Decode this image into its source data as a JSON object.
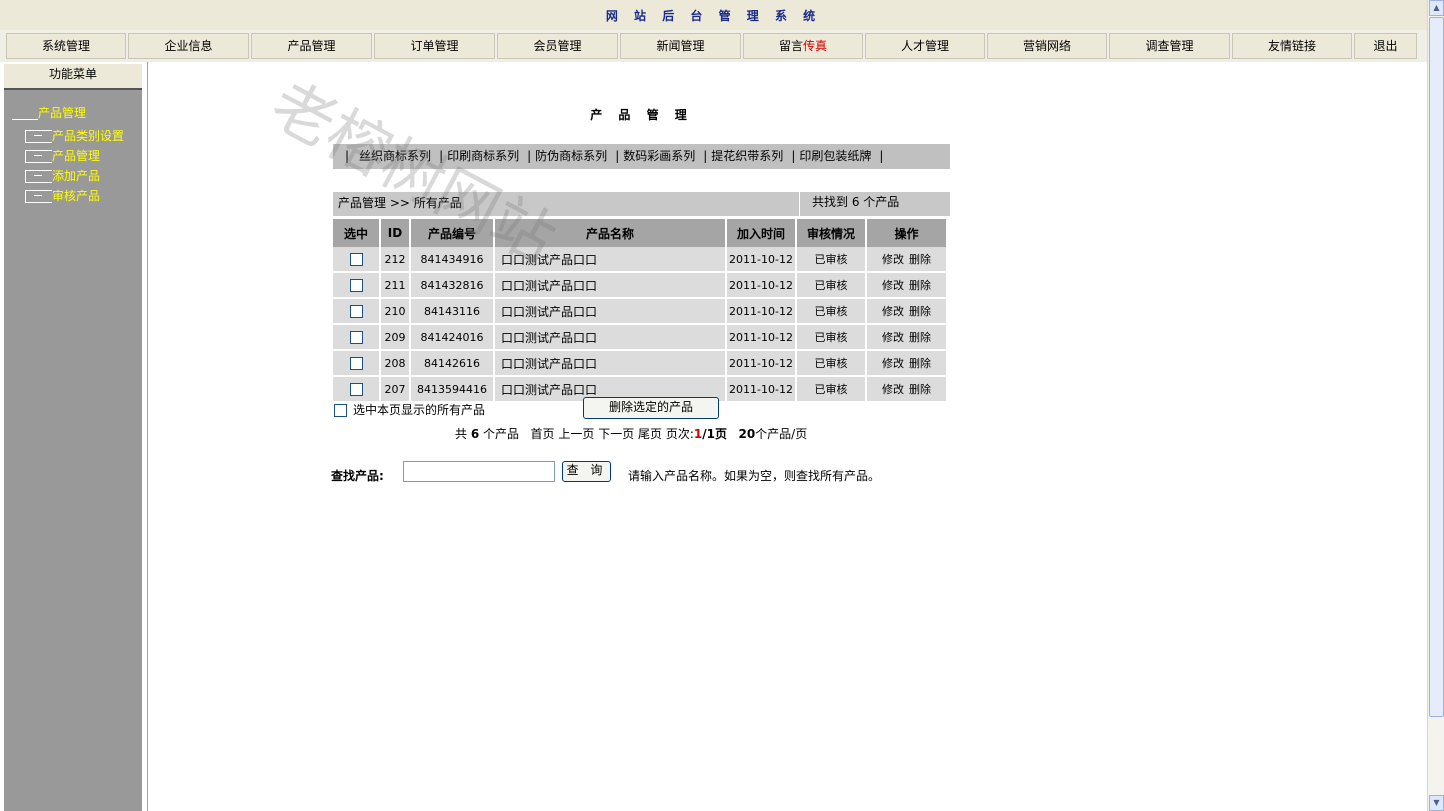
{
  "system_title": "网 站 后 台 管 理 系 统",
  "nav": [
    {
      "label": "系统管理"
    },
    {
      "label": "企业信息"
    },
    {
      "label": "产品管理"
    },
    {
      "label": "订单管理"
    },
    {
      "label": "会员管理"
    },
    {
      "label": "新闻管理"
    },
    {
      "label": "留言",
      "label_red": "传真"
    },
    {
      "label": "人才管理"
    },
    {
      "label": "营销网络"
    },
    {
      "label": "调查管理"
    },
    {
      "label": "友情链接"
    },
    {
      "label": "退出"
    }
  ],
  "sidebar": {
    "title": "功能菜单",
    "root": "产品管理",
    "items": [
      "产品类别设置",
      "产品管理",
      "添加产品",
      "审核产品"
    ]
  },
  "main": {
    "page_title": "产 品 管 理",
    "categories": [
      "丝织商标系列",
      "印刷商标系列",
      "防伪商标系列",
      "数码彩画系列",
      "提花织带系列",
      "印刷包装纸牌"
    ],
    "separator": "|",
    "breadcrumb": "产品管理 >> 所有产品",
    "found_text": "共找到 6 个产品",
    "columns": [
      "选中",
      "ID",
      "产品编号",
      "产品名称",
      "加入时间",
      "审核情况",
      "操作"
    ],
    "rows": [
      {
        "id": "212",
        "code": "841434916",
        "name": "口口测试产品口口",
        "date": "2011-10-12",
        "status": "已审核",
        "edit": "修改",
        "delete": "删除"
      },
      {
        "id": "211",
        "code": "841432816",
        "name": "口口测试产品口口",
        "date": "2011-10-12",
        "status": "已审核",
        "edit": "修改",
        "delete": "删除"
      },
      {
        "id": "210",
        "code": "84143116",
        "name": "口口测试产品口口",
        "date": "2011-10-12",
        "status": "已审核",
        "edit": "修改",
        "delete": "删除"
      },
      {
        "id": "209",
        "code": "841424016",
        "name": "口口测试产品口口",
        "date": "2011-10-12",
        "status": "已审核",
        "edit": "修改",
        "delete": "删除"
      },
      {
        "id": "208",
        "code": "84142616",
        "name": "口口测试产品口口",
        "date": "2011-10-12",
        "status": "已审核",
        "edit": "修改",
        "delete": "删除"
      },
      {
        "id": "207",
        "code": "8413594416",
        "name": "口口测试产品口口",
        "date": "2011-10-12",
        "status": "已审核",
        "edit": "修改",
        "delete": "删除"
      }
    ],
    "select_all_label": "选中本页显示的所有产品",
    "delete_selected_label": "删除选定的产品",
    "pager": {
      "total_prefix": "共",
      "total": "6",
      "total_suffix": "个产品",
      "first": "首页",
      "prev": "上一页",
      "next": "下一页",
      "last": "尾页",
      "page_label": "页次:",
      "page_current": "1",
      "page_total": "/1页",
      "per_page": "20",
      "per_page_suffix": "个产品/页"
    },
    "search": {
      "label": "查找产品:",
      "value": "",
      "button": "查 询",
      "hint": "请输入产品名称。如果为空，则查找所有产品。"
    }
  },
  "watermark": "老榕树网站"
}
